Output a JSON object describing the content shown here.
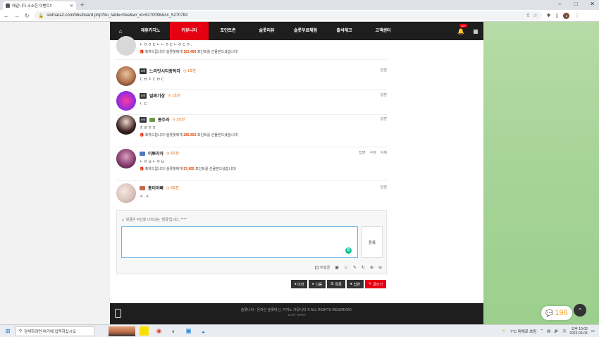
{
  "browser": {
    "tab_title": "애길니다 소소한 이벤트!!",
    "url": "slotnara2.com/bbs/board.php?bo_table=free&wr_id=5270096&#c_5270782"
  },
  "nav": {
    "items": [
      {
        "label": "제휴카지노",
        "active": false
      },
      {
        "label": "커뮤니티",
        "active": true
      },
      {
        "label": "포인트존",
        "active": false
      },
      {
        "label": "슬롯리뷰",
        "active": false
      },
      {
        "label": "슬롯무료체험",
        "active": false
      },
      {
        "label": "출석체크",
        "active": false
      },
      {
        "label": "고객센터",
        "active": false
      }
    ],
    "bell_badge": "12+"
  },
  "comments": [
    {
      "level": "",
      "nick": "",
      "time": "",
      "text": "ㄴㅇㅇㄷㄴㄴㅇㄷㄴㅇㄷㅇ.",
      "point_prefix": "축하드립니다! 슬롯봇에게 ",
      "points": "162,469",
      "point_suffix": " 포인트를 선물받으셨습니다!",
      "actions": []
    },
    {
      "level": "8레",
      "nick": "느리잇시티중독자",
      "time": "1초전",
      "text": "ㄷㅂㅈㄷㅂㄷ",
      "point_prefix": "",
      "points": "",
      "point_suffix": "",
      "actions": [
        "답변"
      ]
    },
    {
      "level": "8레",
      "nick": "일짜기상",
      "time": "1초전",
      "text": "ㄴㄷ",
      "point_prefix": "",
      "points": "",
      "point_suffix": "",
      "actions": [
        "답변"
      ]
    },
    {
      "level": "8레",
      "nick": "콩주라",
      "time": "3초전",
      "text": "ㅎㄹㅎㅎ",
      "point_prefix": "축하드립니다! 슬롯봇에게 ",
      "points": "286,593",
      "point_suffix": " 포인트를 선물받으셨습니다!",
      "actions": [
        "답변"
      ]
    },
    {
      "level": "",
      "nick": "이뽀리아",
      "time": "3초전",
      "text": "ㄴㅇㅂㄴㅇㅂ",
      "point_prefix": "축하드립니다! 슬롯봇에게 ",
      "points": "57,455",
      "point_suffix": " 포인트를 선물받으셨습니다!",
      "actions": [
        "답변",
        "수정",
        "삭제"
      ]
    },
    {
      "level": "",
      "nick": "홍이아빠",
      "time": "3초전",
      "text": "ㅅ.ㅅ",
      "point_prefix": "",
      "points": "",
      "point_suffix": "",
      "actions": [
        "답변"
      ]
    }
  ],
  "reply": {
    "hint": "댓글은 자신을 나타내는 '얼굴'입니다. *^^*",
    "submit": "등록",
    "secret": "비밀글"
  },
  "buttons": {
    "prev": "이전",
    "next": "다음",
    "list": "목록",
    "answer": "답변",
    "write": "글쓰기"
  },
  "footer": {
    "copy": "슬롯나라 - 온라인 슬롯머신, 카지노 커뮤니티 © ALL RIGHTS RESERVED.",
    "sub": "SLOT NARA"
  },
  "chat": {
    "count": "196"
  },
  "taskbar": {
    "search": "검색하려면 여기에 입력하십시오",
    "weather": "7°C 대체로 흐림",
    "time": "오후 10:02",
    "date": "2023-03-04"
  }
}
